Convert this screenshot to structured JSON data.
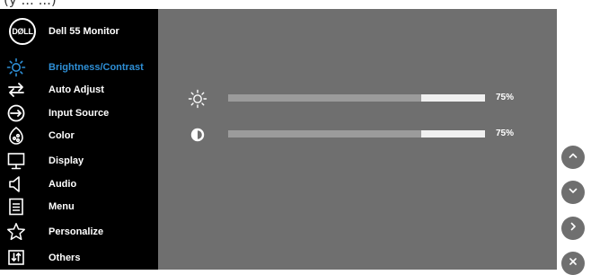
{
  "page": {
    "top_fragment": "(y   ...   ...)"
  },
  "header": {
    "logo_text": "DØLL",
    "model_name": "Dell 55 Monitor"
  },
  "menu": {
    "items": [
      {
        "label": "Brightness/Contrast",
        "icon": "brightness-icon",
        "active": true
      },
      {
        "label": "Auto Adjust",
        "icon": "auto-adjust-icon"
      },
      {
        "label": "Input Source",
        "icon": "input-source-icon"
      },
      {
        "label": "Color",
        "icon": "color-icon"
      },
      {
        "label": "Display",
        "icon": "display-icon"
      },
      {
        "label": "Audio",
        "icon": "audio-icon"
      },
      {
        "label": "Menu",
        "icon": "menu-icon"
      },
      {
        "label": "Personalize",
        "icon": "personalize-icon"
      },
      {
        "label": "Others",
        "icon": "others-icon"
      }
    ]
  },
  "settings": {
    "brightness": {
      "icon": "sun-icon",
      "value": 75,
      "value_text": "75%"
    },
    "contrast": {
      "icon": "contrast-icon",
      "value": 75,
      "value_text": "75%"
    }
  },
  "nav_buttons": [
    {
      "icon": "chevron-up-icon"
    },
    {
      "icon": "chevron-down-icon"
    },
    {
      "icon": "chevron-right-icon"
    },
    {
      "icon": "close-icon"
    }
  ],
  "colors": {
    "sidebar_bg": "#000000",
    "panel_bg": "#6f6f6f",
    "active_text": "#2e8fd6",
    "slider_track": "#9b9b9b",
    "slider_rest": "#f0f0f0",
    "nav_button_bg": "#6f6f6f"
  }
}
